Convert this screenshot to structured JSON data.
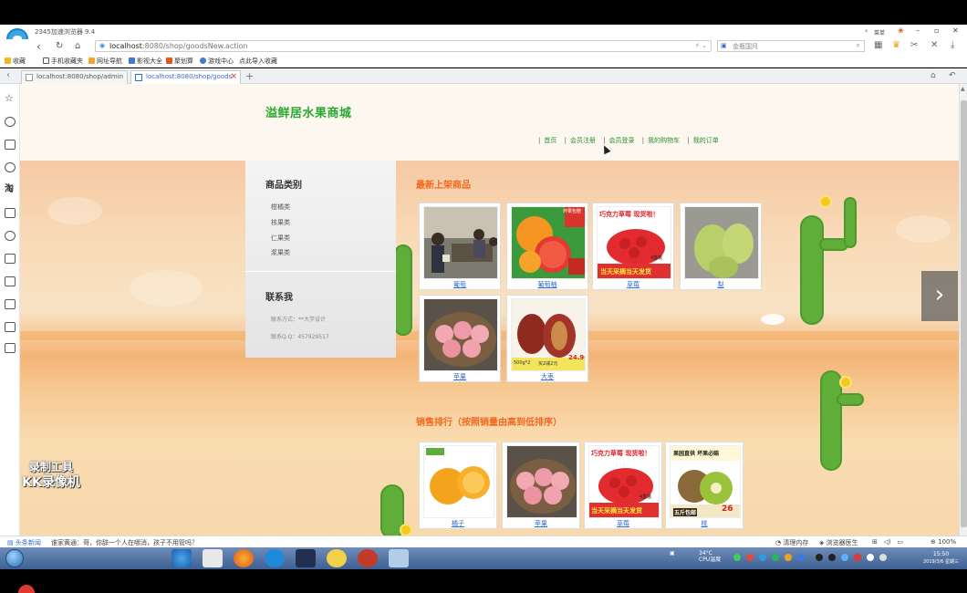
{
  "browser": {
    "title": "2345加速浏览器 9.4",
    "address": {
      "host": "localhost",
      "path": ":8080/shop/goodsNew.action"
    },
    "search_placeholder": "金瓶国月",
    "right_top_label": "菜单",
    "bookmarks": [
      "收藏",
      "手机收藏夹",
      "网址导航",
      "影视大全",
      "聚划算",
      "游戏中心",
      "点此导入收藏"
    ],
    "tabs": [
      {
        "label": "localhost:8080/shop/admin",
        "active": false
      },
      {
        "label": "localhost:8080/shop/goods",
        "active": true
      }
    ]
  },
  "site": {
    "title": "溢鲜居水果商城",
    "nav": [
      "首页",
      "会员注册",
      "会员登录",
      "我的购物车",
      "我的订单"
    ]
  },
  "categories": {
    "title": "商品类别",
    "items": [
      "柑橘类",
      "核果类",
      "仁果类",
      "浆果类"
    ]
  },
  "contact": {
    "title": "联系我",
    "lines": [
      "联系方式：**大学设计",
      "联系Q.Q：457929517"
    ]
  },
  "new_products": {
    "title": "最新上架商品",
    "items": [
      {
        "name": "葡萄",
        "kind": "meeting"
      },
      {
        "name": "葡萄柚",
        "kind": "grapefruit"
      },
      {
        "name": "草莓",
        "kind": "strawberry"
      },
      {
        "name": "梨",
        "kind": "pear"
      },
      {
        "name": "苹果",
        "kind": "apple"
      },
      {
        "name": "大枣",
        "kind": "date"
      }
    ]
  },
  "sales_rank": {
    "title": "销售排行（按照销量由高到低排序）",
    "items": [
      {
        "name": "橘子",
        "kind": "orange"
      },
      {
        "name": "苹果",
        "kind": "apple"
      },
      {
        "name": "草莓",
        "kind": "strawberry"
      },
      {
        "name": "桃",
        "kind": "kiwi"
      }
    ]
  },
  "promo_text": {
    "strawberry_top": "巧克力草莓 现货啦！",
    "strawberry_bottom": "当天采摘当天发货",
    "strawberry_box": "4盒装",
    "grapefruit_badge": "坏果包赔",
    "date_text": "买2减2元",
    "date_price": "24.90",
    "date_weight": "500g*2",
    "kiwi_top": "果园直供  坏果必赔",
    "kiwi_bottom": "五斤包邮",
    "kiwi_price": "26"
  },
  "watermark": {
    "line1": "录制工具",
    "line2": "KK录像机"
  },
  "status": {
    "left_label": "头条新闻",
    "news": "谁家黄通：哥，你辞一个人在哪消，孩子不用管吗？",
    "right_items": [
      "清理内存",
      "浏览器医生"
    ],
    "zoom": "100%"
  },
  "taskbar": {
    "temperature": "34°C",
    "cpu": "CPU温度",
    "time": "15:50",
    "date": "2019/3/6 星期三"
  },
  "colors": {
    "site_green": "#2aa832",
    "section_orange": "#f06a22",
    "link_blue": "#2f6ad0"
  }
}
